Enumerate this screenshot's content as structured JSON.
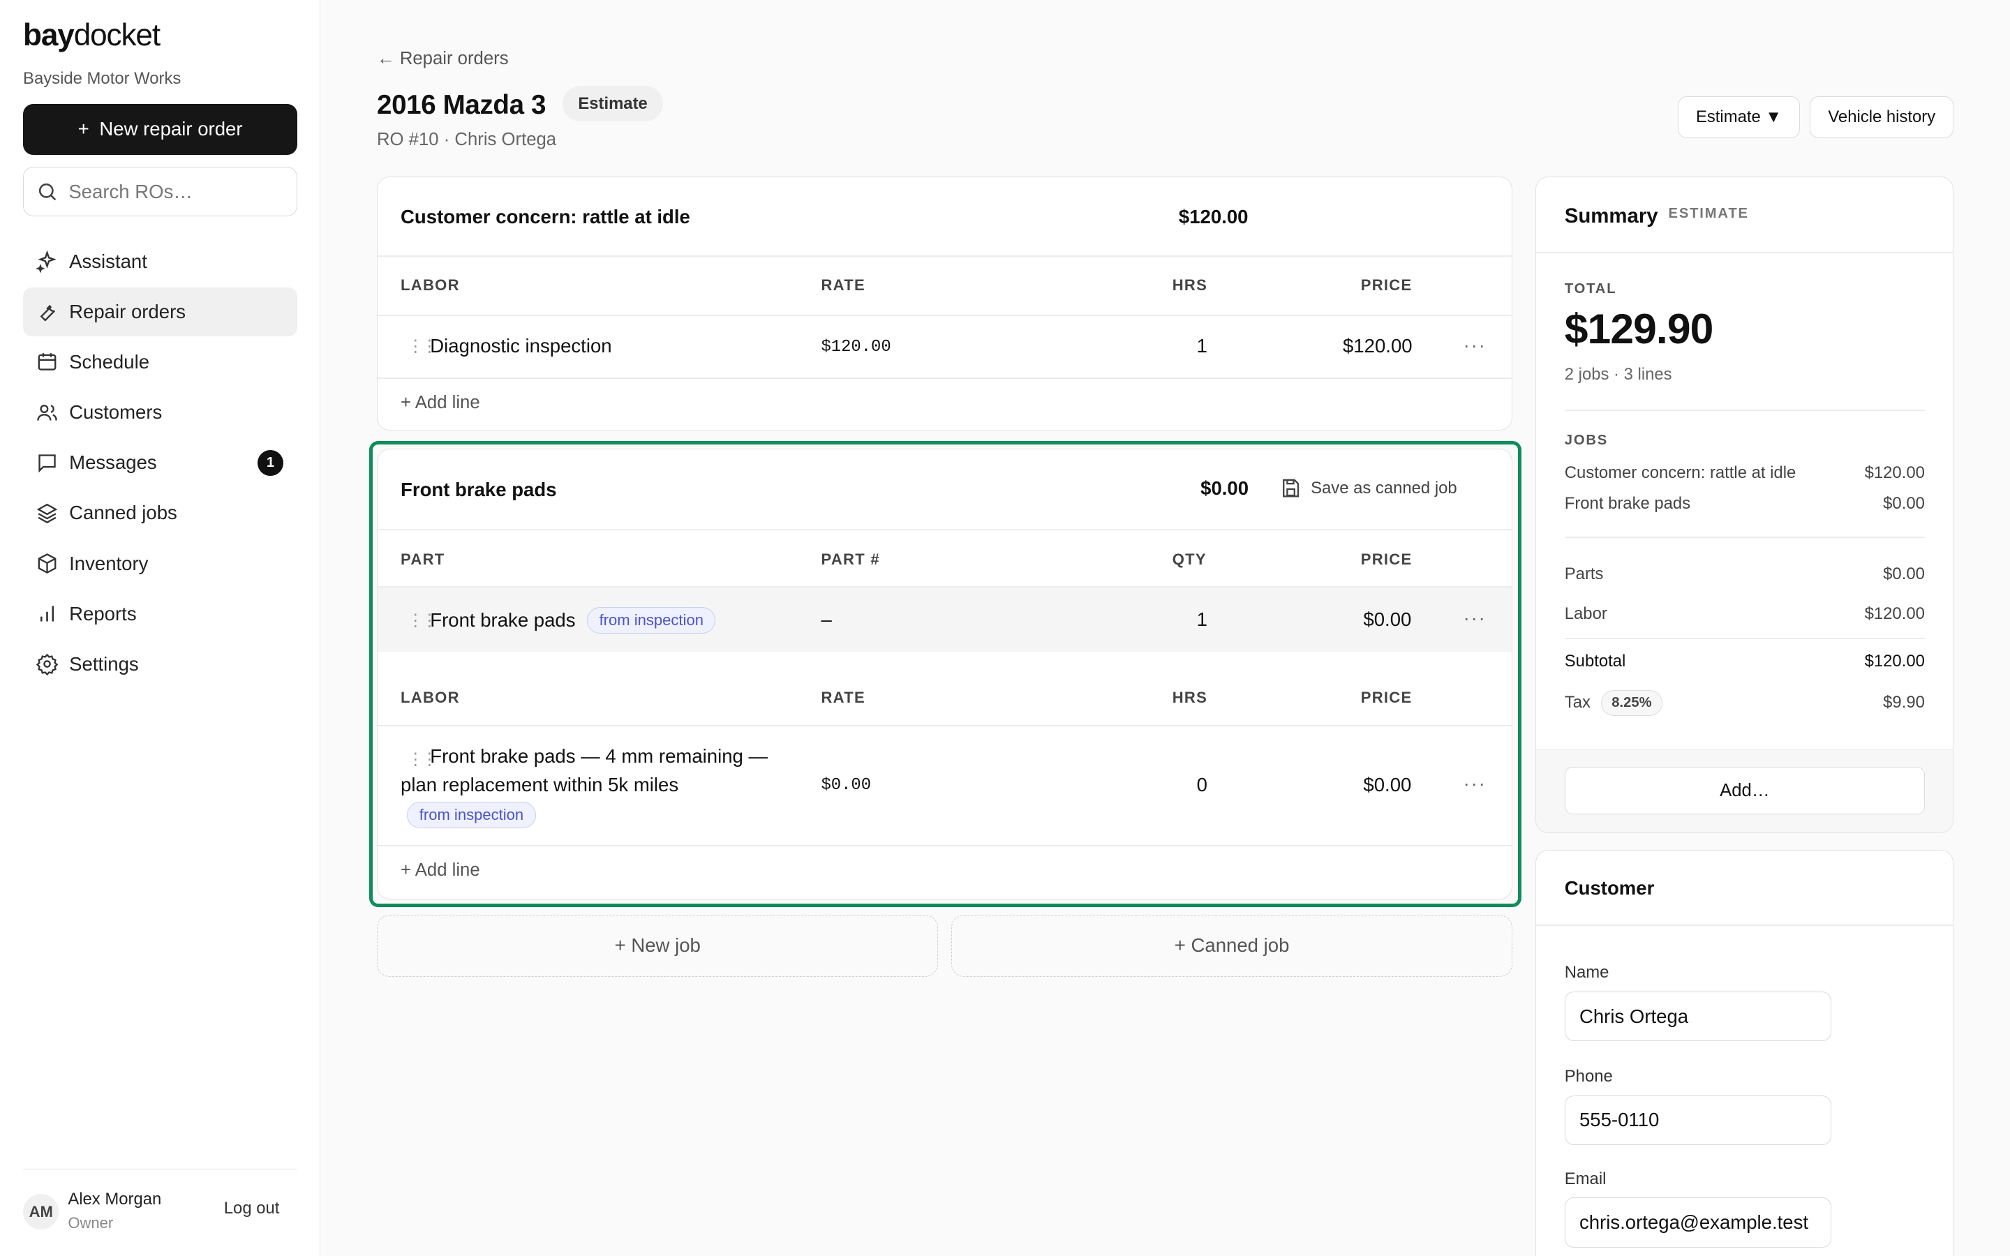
{
  "brand": {
    "bold": "bay",
    "regular": "docket",
    "shop": "Bayside Motor Works"
  },
  "sidebar": {
    "new_button": "New repair order",
    "new_button_icon": "+",
    "search_placeholder": "Search ROs…",
    "items": [
      {
        "label": "Assistant",
        "icon": "sparkle-icon"
      },
      {
        "label": "Repair orders",
        "icon": "wrench-icon",
        "active": true
      },
      {
        "label": "Schedule",
        "icon": "calendar-icon"
      },
      {
        "label": "Customers",
        "icon": "users-icon"
      },
      {
        "label": "Messages",
        "icon": "message-icon",
        "badge": "1"
      },
      {
        "label": "Canned jobs",
        "icon": "layers-icon"
      },
      {
        "label": "Inventory",
        "icon": "box-icon"
      },
      {
        "label": "Reports",
        "icon": "bar-chart-icon"
      },
      {
        "label": "Settings",
        "icon": "gear-icon"
      }
    ],
    "user": {
      "initials": "AM",
      "name": "Alex Morgan",
      "role": "Owner",
      "logout": "Log out"
    }
  },
  "header": {
    "back": "← Repair orders",
    "title": "2016 Mazda 3",
    "status": "Estimate",
    "subtitle": "RO #10 · Chris Ortega",
    "status_dropdown": "Estimate ▼",
    "vehicle_history": "Vehicle history"
  },
  "jobs": [
    {
      "title": "Customer concern: rattle at idle",
      "total": "$120.00",
      "labor_headers": [
        "LABOR",
        "RATE",
        "HRS",
        "PRICE"
      ],
      "labor": [
        {
          "name": "Diagnostic inspection",
          "rate": "$120.00",
          "hrs": "1",
          "price": "$120.00"
        }
      ],
      "add_line": "+ Add line"
    },
    {
      "title": "Front brake pads",
      "total": "$0.00",
      "save_canned": "Save as canned job",
      "part_headers": [
        "PART",
        "PART #",
        "QTY",
        "PRICE"
      ],
      "parts": [
        {
          "name": "Front brake pads",
          "tag": "from inspection",
          "part_no": "–",
          "qty": "1",
          "price": "$0.00"
        }
      ],
      "labor_headers": [
        "LABOR",
        "RATE",
        "HRS",
        "PRICE"
      ],
      "labor": [
        {
          "name_line1": "Front brake pads — 4 mm remaining —",
          "name_line2": "plan replacement within 5k miles",
          "tag": "from inspection",
          "rate": "$0.00",
          "hrs": "0",
          "price": "$0.00"
        }
      ],
      "add_line": "+ Add line"
    }
  ],
  "actions": {
    "new_job": "+ New job",
    "canned_job": "+ Canned job",
    "more": "···"
  },
  "summary": {
    "title": "Summary",
    "tag": "ESTIMATE",
    "total_label": "TOTAL",
    "total": "$129.90",
    "meta": "2 jobs · 3 lines",
    "jobs_label": "JOBS",
    "jobs": [
      {
        "name": "Customer concern: rattle at idle",
        "amount": "$120.00"
      },
      {
        "name": "Front brake pads",
        "amount": "$0.00"
      }
    ],
    "parts_label": "Parts",
    "parts": "$0.00",
    "labor_label": "Labor",
    "labor": "$120.00",
    "subtotal_label": "Subtotal",
    "subtotal": "$120.00",
    "tax_label": "Tax",
    "tax_rate": "8.25%",
    "tax": "$9.90",
    "add_button": "Add…"
  },
  "customer": {
    "title": "Customer",
    "name_label": "Name",
    "name": "Chris Ortega",
    "phone_label": "Phone",
    "phone": "555-0110",
    "email_label": "Email",
    "email": "chris.ortega@example.test"
  },
  "colors": {
    "accent_frame": "#0f8c5b",
    "tag_text": "#4b53c9",
    "primary_button": "#161616"
  }
}
